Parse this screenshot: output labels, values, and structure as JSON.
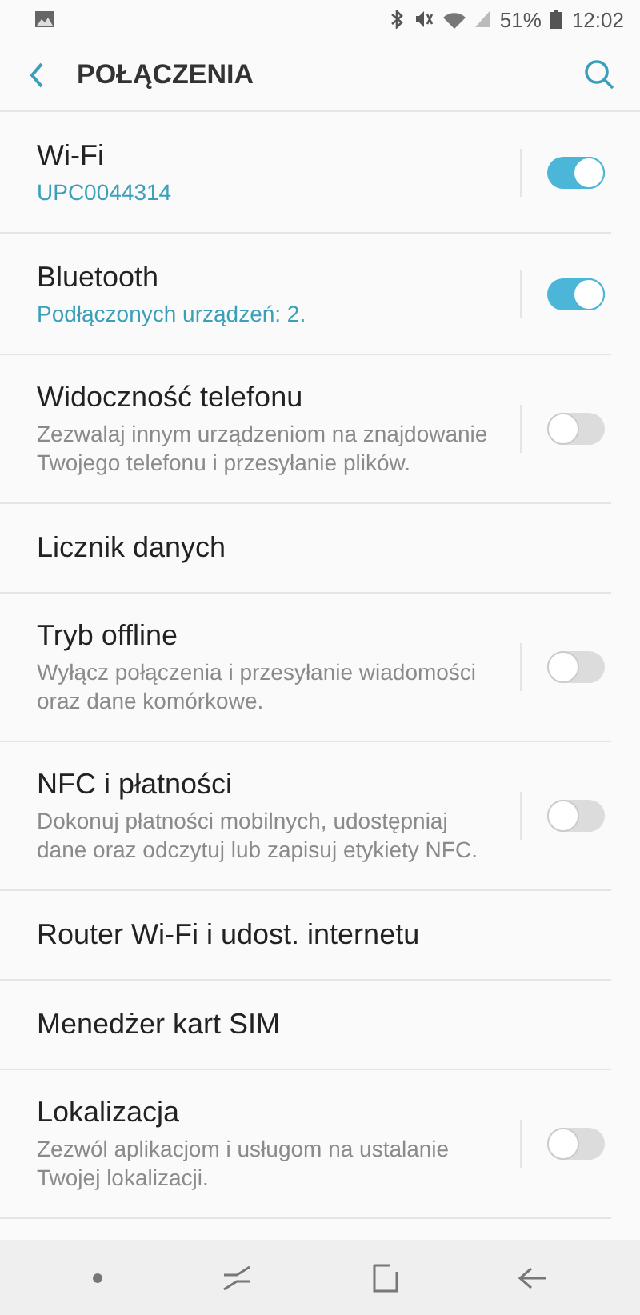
{
  "status_bar": {
    "battery": "51%",
    "time": "12:02"
  },
  "header": {
    "title": "POŁĄCZENIA"
  },
  "items": [
    {
      "kind": "toggle",
      "title": "Wi-Fi",
      "subtitle": "UPC0044314",
      "on": true
    },
    {
      "kind": "toggle",
      "title": "Bluetooth",
      "subtitle": "Podłączonych urządzeń: 2.",
      "on": true
    },
    {
      "kind": "toggle",
      "title": "Widoczność telefonu",
      "subtitle": "Zezwalaj innym urządzeniom na znajdowanie Twojego telefonu i przesyłanie plików.",
      "on": false
    },
    {
      "kind": "link",
      "title": "Licznik danych"
    },
    {
      "kind": "toggle",
      "title": "Tryb offline",
      "subtitle": "Wyłącz połączenia i przesyłanie wiadomości oraz dane komórkowe.",
      "on": false
    },
    {
      "kind": "toggle",
      "title": "NFC i płatności",
      "subtitle": "Dokonuj płatności mobilnych, udostępniaj dane oraz odczytuj lub zapisuj etykiety NFC.",
      "on": false
    },
    {
      "kind": "link",
      "title": "Router Wi-Fi i udost. internetu"
    },
    {
      "kind": "link",
      "title": "Menedżer kart SIM"
    },
    {
      "kind": "toggle",
      "title": "Lokalizacja",
      "subtitle": "Zezwól aplikacjom i usługom na ustalanie Twojej lokalizacji.",
      "on": false
    }
  ]
}
